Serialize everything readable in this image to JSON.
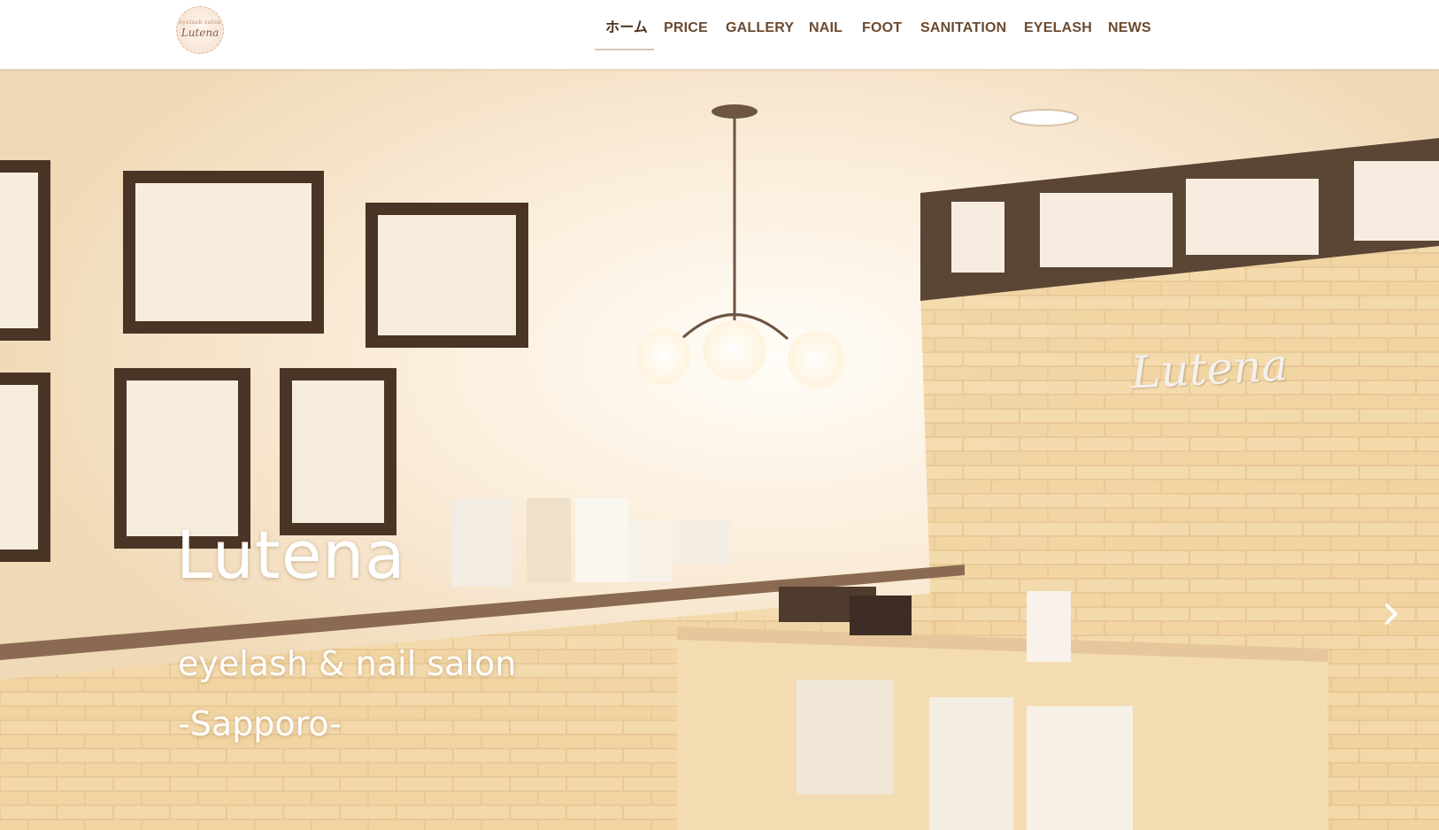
{
  "header": {
    "logo": {
      "small_text": "eyelash salon",
      "name": "Lutena"
    },
    "nav": [
      {
        "label": "ホーム",
        "active": true
      },
      {
        "label": "PRICE"
      },
      {
        "label": "GALLERY"
      },
      {
        "label": "NAIL"
      },
      {
        "label": "FOOT"
      },
      {
        "label": "SANITATION"
      },
      {
        "label": "EYELASH"
      },
      {
        "label": "NEWS"
      }
    ]
  },
  "hero": {
    "title": "Lutena",
    "subtitle_line1": "eyelash & nail salon",
    "subtitle_line2": "-Sapporo-",
    "wall_sign": "Lutena",
    "next_icon": "chevron-right-icon"
  },
  "colors": {
    "nav_text": "#6b4a2f",
    "active_underline": "#d8c4b4",
    "hero_text": "#ffffff"
  }
}
